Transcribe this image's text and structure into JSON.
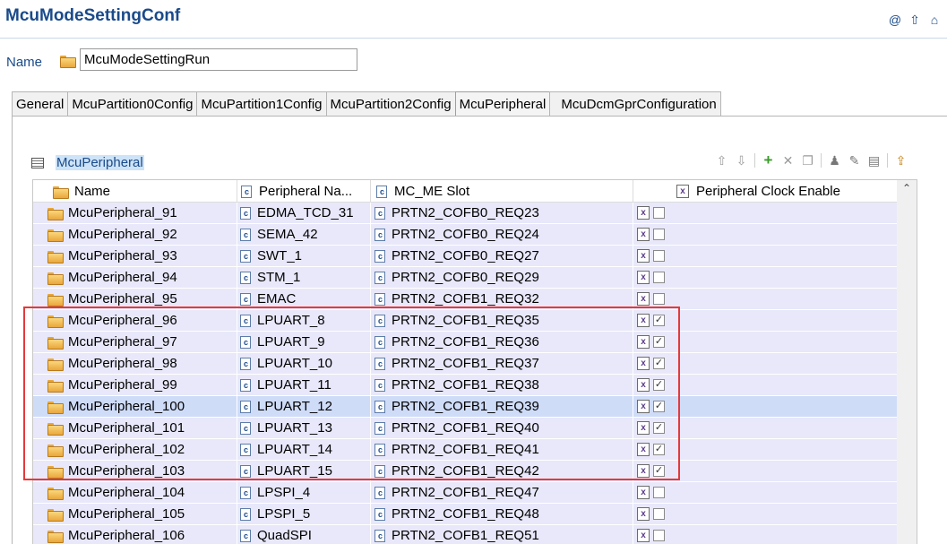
{
  "header": {
    "title": "McuModeSettingConf",
    "icons": [
      "at-icon",
      "up-arrow-icon",
      "home-icon"
    ]
  },
  "name_field": {
    "label": "Name",
    "value": "McuModeSettingRun"
  },
  "tabs": [
    {
      "label": "General",
      "active": false
    },
    {
      "label": "McuPartition0Config",
      "active": false
    },
    {
      "label": "McuPartition1Config",
      "active": false
    },
    {
      "label": "McuPartition2Config",
      "active": false
    },
    {
      "label": "McuPeripheral",
      "active": true
    },
    {
      "label": "McuDcmGprConfiguration",
      "active": false
    }
  ],
  "section": {
    "title": "McuPeripheral",
    "toolbar": [
      "move-up-icon",
      "move-down-icon",
      "add-icon",
      "delete-icon",
      "copy-icon",
      "user-icon",
      "edit-icon",
      "rename-icon",
      "import-icon"
    ]
  },
  "table": {
    "columns": [
      "Name",
      "Peripheral Na...",
      "MC_ME Slot",
      "Peripheral Clock Enable"
    ],
    "rows": [
      {
        "name": "McuPeripheral_91",
        "periph": "EDMA_TCD_31",
        "slot": "PRTN2_COFB0_REQ23",
        "enabled": false,
        "selected": false
      },
      {
        "name": "McuPeripheral_92",
        "periph": "SEMA_42",
        "slot": "PRTN2_COFB0_REQ24",
        "enabled": false,
        "selected": false
      },
      {
        "name": "McuPeripheral_93",
        "periph": "SWT_1",
        "slot": "PRTN2_COFB0_REQ27",
        "enabled": false,
        "selected": false
      },
      {
        "name": "McuPeripheral_94",
        "periph": "STM_1",
        "slot": "PRTN2_COFB0_REQ29",
        "enabled": false,
        "selected": false
      },
      {
        "name": "McuPeripheral_95",
        "periph": "EMAC",
        "slot": "PRTN2_COFB1_REQ32",
        "enabled": false,
        "selected": false
      },
      {
        "name": "McuPeripheral_96",
        "periph": "LPUART_8",
        "slot": "PRTN2_COFB1_REQ35",
        "enabled": true,
        "selected": false
      },
      {
        "name": "McuPeripheral_97",
        "periph": "LPUART_9",
        "slot": "PRTN2_COFB1_REQ36",
        "enabled": true,
        "selected": false
      },
      {
        "name": "McuPeripheral_98",
        "periph": "LPUART_10",
        "slot": "PRTN2_COFB1_REQ37",
        "enabled": true,
        "selected": false
      },
      {
        "name": "McuPeripheral_99",
        "periph": "LPUART_11",
        "slot": "PRTN2_COFB1_REQ38",
        "enabled": true,
        "selected": false
      },
      {
        "name": "McuPeripheral_100",
        "periph": "LPUART_12",
        "slot": "PRTN2_COFB1_REQ39",
        "enabled": true,
        "selected": true
      },
      {
        "name": "McuPeripheral_101",
        "periph": "LPUART_13",
        "slot": "PRTN2_COFB1_REQ40",
        "enabled": true,
        "selected": false
      },
      {
        "name": "McuPeripheral_102",
        "periph": "LPUART_14",
        "slot": "PRTN2_COFB1_REQ41",
        "enabled": true,
        "selected": false
      },
      {
        "name": "McuPeripheral_103",
        "periph": "LPUART_15",
        "slot": "PRTN2_COFB1_REQ42",
        "enabled": true,
        "selected": false
      },
      {
        "name": "McuPeripheral_104",
        "periph": "LPSPI_4",
        "slot": "PRTN2_COFB1_REQ47",
        "enabled": false,
        "selected": false
      },
      {
        "name": "McuPeripheral_105",
        "periph": "LPSPI_5",
        "slot": "PRTN2_COFB1_REQ48",
        "enabled": false,
        "selected": false
      },
      {
        "name": "McuPeripheral_106",
        "periph": "QuadSPI",
        "slot": "PRTN2_COFB1_REQ51",
        "enabled": false,
        "selected": false
      }
    ]
  },
  "colors": {
    "title": "#1a4a8a",
    "row_bg": "#e8e8fa",
    "row_selected": "#cfdcf8",
    "highlight_box": "#e5393a"
  }
}
